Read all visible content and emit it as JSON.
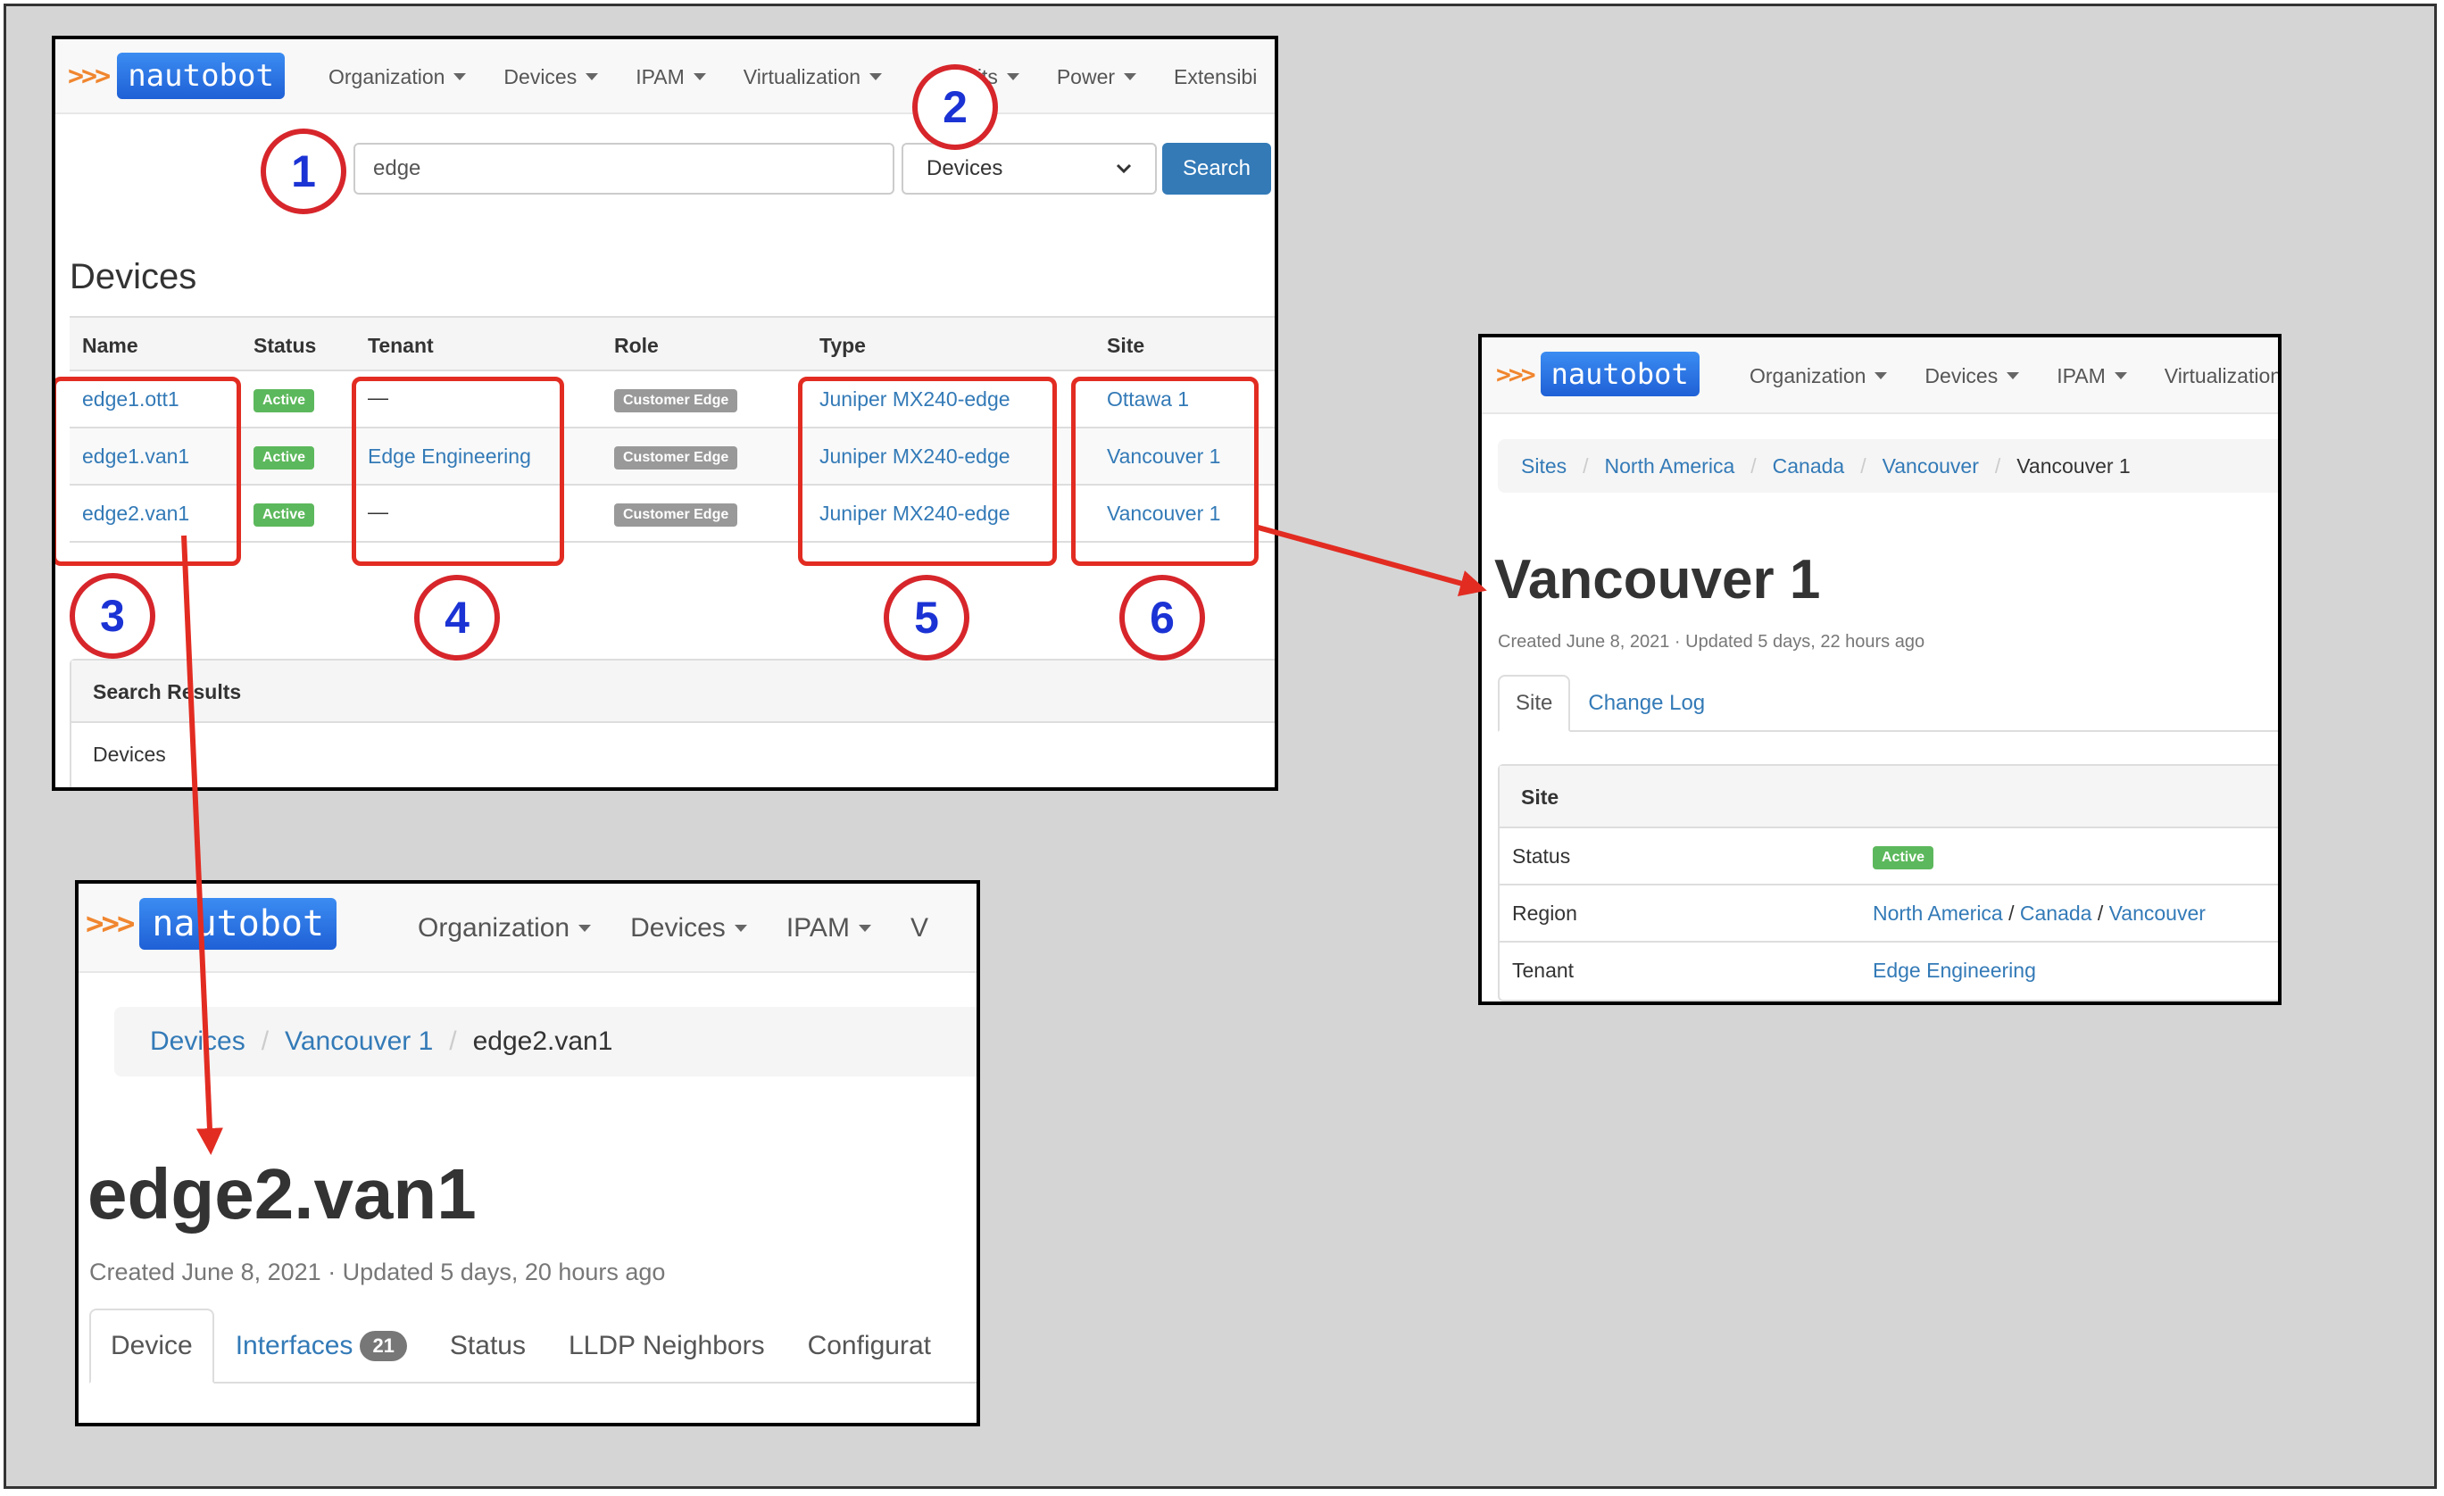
{
  "nav": {
    "logo_text": "nautobot",
    "logo_chevrons": ">>>",
    "items": [
      "Organization",
      "Devices",
      "IPAM",
      "Virtualization",
      "Circuits",
      "Power",
      "Extensibility"
    ],
    "items_panel1_visible": [
      "Organization",
      "Devices",
      "IPAM",
      "Virtualization",
      "uits",
      "Power",
      "Extensibi"
    ],
    "items_panel2_visible": [
      "Organization",
      "Devices",
      "IPAM",
      "Virtualization"
    ],
    "items_panel3_visible": [
      "Organization",
      "Devices",
      "IPAM",
      "V"
    ]
  },
  "search": {
    "query": "edge",
    "scope": "Devices",
    "button": "Search"
  },
  "devices": {
    "heading": "Devices",
    "columns": [
      "Name",
      "Status",
      "Tenant",
      "Role",
      "Type",
      "Site"
    ],
    "rows": [
      {
        "name": "edge1.ott1",
        "status": "Active",
        "tenant": "—",
        "role": "Customer Edge",
        "type": "Juniper MX240-edge",
        "site": "Ottawa 1"
      },
      {
        "name": "edge1.van1",
        "status": "Active",
        "tenant": "Edge Engineering",
        "role": "Customer Edge",
        "type": "Juniper MX240-edge",
        "site": "Vancouver 1"
      },
      {
        "name": "edge2.van1",
        "status": "Active",
        "tenant": "—",
        "role": "Customer Edge",
        "type": "Juniper MX240-edge",
        "site": "Vancouver 1"
      }
    ],
    "results_heading": "Search Results",
    "results_item": "Devices"
  },
  "callouts": [
    "1",
    "2",
    "3",
    "4",
    "5",
    "6"
  ],
  "site_page": {
    "breadcrumb": [
      "Sites",
      "North America",
      "Canada",
      "Vancouver",
      "Vancouver 1"
    ],
    "title": "Vancouver 1",
    "meta": "Created June 8, 2021 · Updated 5 days, 22 hours ago",
    "tabs": [
      "Site",
      "Change Log"
    ],
    "panel_heading": "Site",
    "status_label": "Status",
    "status_value": "Active",
    "region_label": "Region",
    "region_path": [
      "North America",
      "Canada",
      "Vancouver"
    ],
    "region_sep": "/",
    "tenant_label": "Tenant",
    "tenant_value": "Edge Engineering"
  },
  "device_page": {
    "breadcrumb": [
      "Devices",
      "Vancouver 1",
      "edge2.van1"
    ],
    "title": "edge2.van1",
    "meta": "Created June 8, 2021 · Updated 5 days, 20 hours ago",
    "tabs": [
      "Device",
      "Interfaces",
      "Status",
      "LLDP Neighbors",
      "Configurat"
    ],
    "interfaces_count": "21"
  },
  "colors": {
    "link": "#337ab7",
    "active_badge": "#5cb85c",
    "role_badge": "#999999",
    "callout_border": "#d7262b",
    "callout_text": "#1b33d4",
    "highlight_box": "#e22c22",
    "search_button": "#337ab7"
  }
}
